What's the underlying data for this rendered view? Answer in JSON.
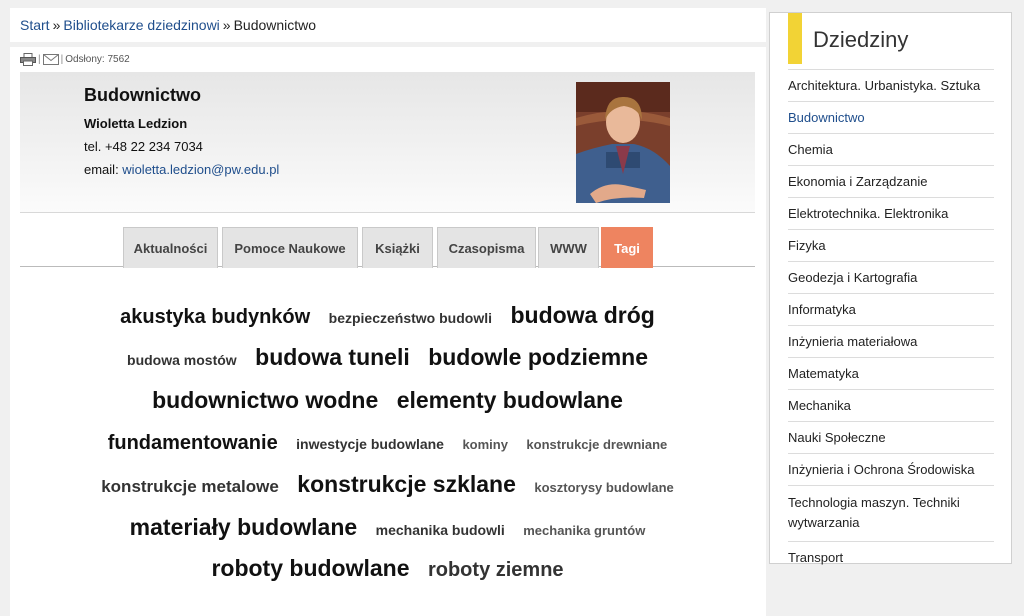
{
  "breadcrumb": {
    "items": [
      "Start",
      "Bibliotekarze dziedzinowi",
      "Budownictwo"
    ],
    "separator": "»"
  },
  "toolbar": {
    "print_icon": "printer-icon",
    "mail_icon": "envelope-icon",
    "views_text": "Odsłony: 7562"
  },
  "profile": {
    "department": "Budownictwo",
    "name": "Wioletta Ledzion",
    "tel": "tel. +48 22 234 7034",
    "email_label": "email: ",
    "email": "wioletta.ledzion@pw.edu.pl"
  },
  "tabs": [
    "Aktualności",
    "Pomoce Naukowe",
    "Książki",
    "Czasopisma",
    "WWW",
    "Tagi"
  ],
  "active_tab": "Tagi",
  "tags": [
    [
      "akustyka budynków",
      "bezpieczeństwo budowli",
      "budowa dróg"
    ],
    [
      "budowa mostów",
      "budowa tuneli",
      "budowle podziemne"
    ],
    [
      "budownictwo wodne",
      "elementy budowlane"
    ],
    [
      "fundamentowanie",
      "inwestycje budowlane",
      "kominy",
      "konstrukcje drewniane"
    ],
    [
      "konstrukcje metalowe",
      "konstrukcje szklane",
      "kosztorysy budowlane"
    ],
    [
      "materiały budowlane",
      "mechanika budowli",
      "mechanika gruntów"
    ],
    [
      "roboty budowlane",
      "roboty ziemne"
    ]
  ],
  "sidebar": {
    "title": "Dziedziny",
    "items": [
      "Architektura. Urbanistyka. Sztuka",
      "Budownictwo",
      "Chemia",
      "Ekonomia i Zarządzanie",
      "Elektrotechnika. Elektronika",
      "Fizyka",
      "Geodezja i Kartografia",
      "Informatyka",
      "Inżynieria materiałowa",
      "Matematyka",
      "Mechanika",
      "Nauki Społeczne",
      "Inżynieria i Ochrona Środowiska",
      "Technologia maszyn. Techniki wytwarzania",
      "Transport"
    ],
    "selected": "Budownictwo"
  },
  "colors": {
    "link": "#1f4e8c",
    "active_tab": "#ee8460",
    "accent_bar": "#f2d335"
  }
}
